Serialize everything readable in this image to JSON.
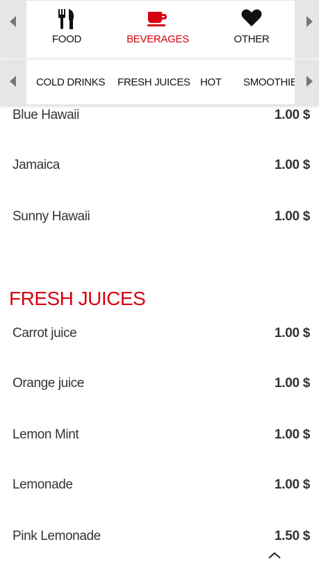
{
  "categories": [
    {
      "label": "FOOD",
      "icon": "fork-knife-icon",
      "active": false
    },
    {
      "label": "BEVERAGES",
      "icon": "coffee-cup-icon",
      "active": true
    },
    {
      "label": "OTHER",
      "icon": "heart-icon",
      "active": false
    }
  ],
  "subcategories": [
    "COLD DRINKS",
    "FRESH JUICES",
    "HOT",
    "SMOOTHIES"
  ],
  "cold_drinks": [
    {
      "name": "Blue Hawaii",
      "price": "1.00 $"
    },
    {
      "name": "Jamaica",
      "price": "1.00 $"
    },
    {
      "name": "Sunny Hawaii",
      "price": "1.00 $"
    }
  ],
  "fresh_juices": {
    "title": "FRESH JUICES",
    "items": [
      {
        "name": "Carrot juice",
        "price": "1.00 $"
      },
      {
        "name": "Orange juice",
        "price": "1.00 $"
      },
      {
        "name": "Lemon Mint",
        "price": "1.00 $"
      },
      {
        "name": "Lemonade",
        "price": "1.00 $"
      },
      {
        "name": "Pink Lemonade",
        "price": "1.50 $"
      }
    ]
  },
  "colors": {
    "accent": "#d7000f",
    "text": "#333333",
    "bar_bg": "#e6e6e6"
  }
}
